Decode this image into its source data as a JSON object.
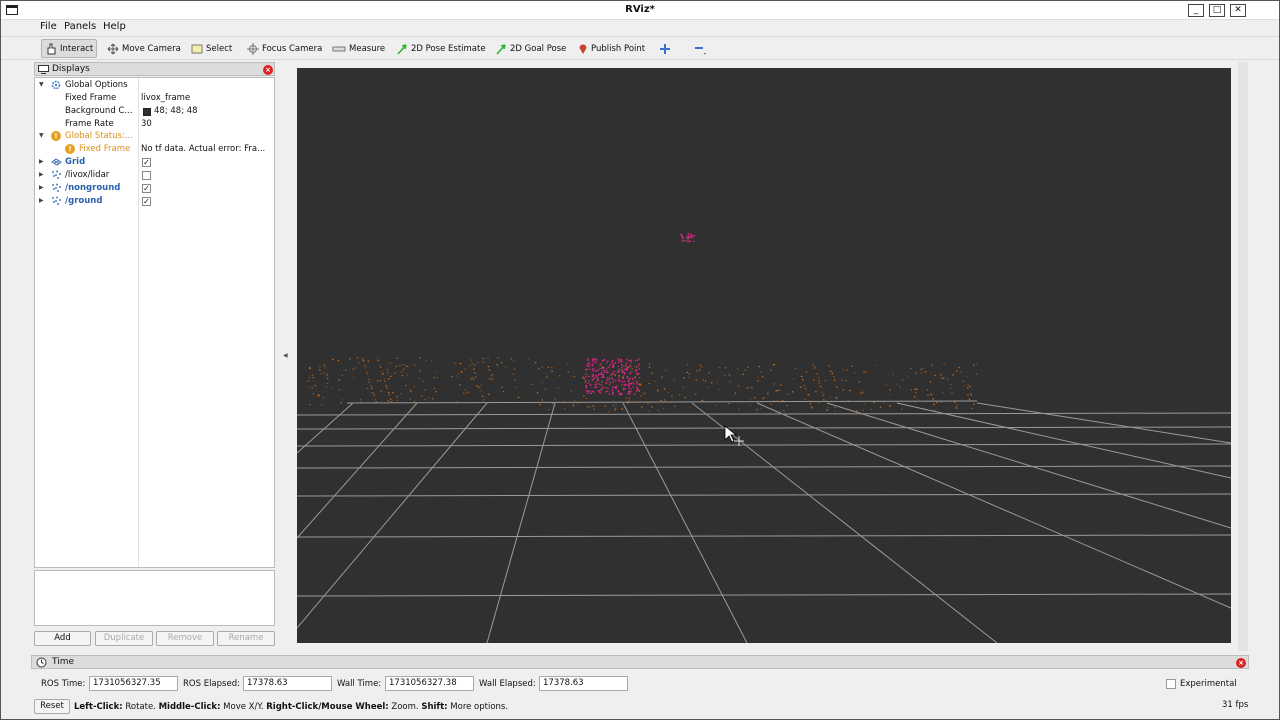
{
  "window": {
    "title": "RViz*",
    "controls": {
      "minimize": "_",
      "maximize": "□",
      "close": "✕"
    }
  },
  "menu": [
    "File",
    "Panels",
    "Help"
  ],
  "toolbar": {
    "tools": [
      "Interact",
      "Move Camera",
      "Select",
      "Focus Camera",
      "Measure",
      "2D Pose Estimate",
      "2D Goal Pose",
      "Publish Point"
    ],
    "active": "Interact"
  },
  "displays": {
    "title": "Displays",
    "rows": [
      {
        "name": "Global Options",
        "value": ""
      },
      {
        "name": "Fixed Frame",
        "value": "livox_frame"
      },
      {
        "name": "Background C...",
        "value": "48; 48; 48",
        "color": "#303030"
      },
      {
        "name": "Frame Rate",
        "value": "30"
      },
      {
        "name": "Global Status:...",
        "value": ""
      },
      {
        "name": "Fixed Frame",
        "value": "No tf data.  Actual error: Fra..."
      },
      {
        "name": "Grid",
        "checked": true
      },
      {
        "name": "/livox/lidar",
        "checked": false
      },
      {
        "name": "/nonground",
        "checked": true
      },
      {
        "name": "/ground",
        "checked": true
      }
    ],
    "buttons": {
      "add": "Add",
      "duplicate": "Duplicate",
      "remove": "Remove",
      "rename": "Rename"
    }
  },
  "viewport": {
    "background": "#303030",
    "grid_color": "#9a9a9a",
    "ground_color": "#e0781f",
    "nonground_color": "#e0288a"
  },
  "time": {
    "title": "Time",
    "ros_time_label": "ROS Time:",
    "ros_time": "1731056327.35",
    "ros_elapsed_label": "ROS Elapsed:",
    "ros_elapsed": "17378.63",
    "wall_time_label": "Wall Time:",
    "wall_time": "1731056327.38",
    "wall_elapsed_label": "Wall Elapsed:",
    "wall_elapsed": "17378.63",
    "experimental_label": "Experimental",
    "reset_label": "Reset",
    "hint": {
      "left_key": "Left-Click:",
      "left_text": " Rotate. ",
      "middle_key": "Middle-Click:",
      "middle_text": " Move X/Y. ",
      "right_key": "Right-Click/Mouse Wheel:",
      "right_text": " Zoom. ",
      "shift_key": "Shift:",
      "shift_text": " More options."
    },
    "fps": "31 fps"
  }
}
